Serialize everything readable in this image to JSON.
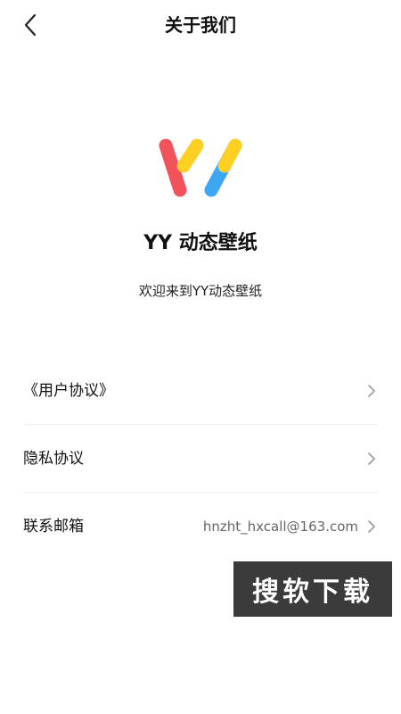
{
  "header": {
    "title": "关于我们",
    "back_icon": "chevron-left-icon"
  },
  "app": {
    "logo_icon": "yy-logo",
    "name": "YY 动态壁纸",
    "welcome": "欢迎来到YY动态壁纸"
  },
  "list": {
    "items": [
      {
        "label": "《用户协议》",
        "value": ""
      },
      {
        "label": "隐私协议",
        "value": ""
      },
      {
        "label": "联系邮箱",
        "value": "hnzht_hxcall@163.com"
      }
    ],
    "chevron_icon": "chevron-right-icon"
  },
  "watermark": {
    "text": "搜软下载"
  },
  "colors": {
    "logo_red": "#f2525a",
    "logo_yellow": "#ffd024",
    "logo_blue": "#3ea7f4",
    "watermark_bg": "#3b3b3b"
  }
}
